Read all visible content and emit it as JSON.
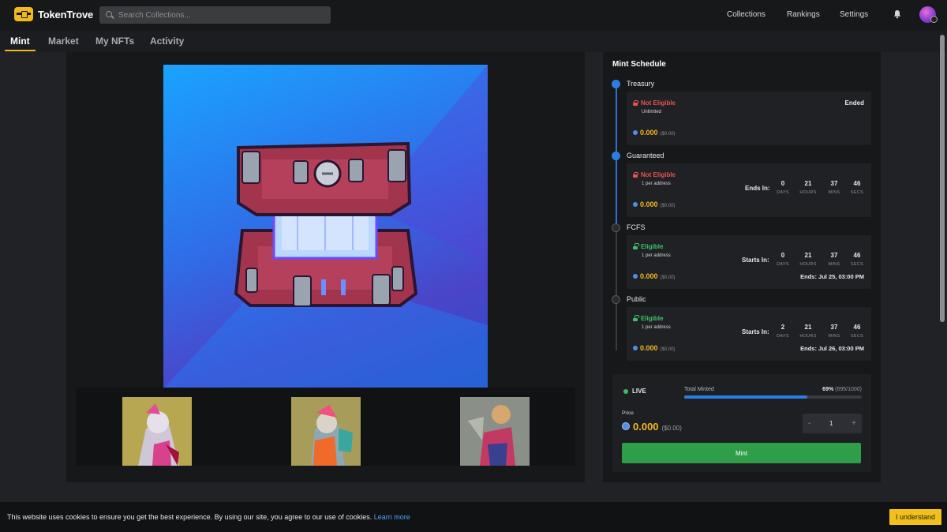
{
  "app": {
    "brand": "TokenTrove"
  },
  "search": {
    "placeholder": "Search Collections..."
  },
  "topnav": {
    "collections": "Collections",
    "rankings": "Rankings",
    "settings": "Settings"
  },
  "tabs": [
    {
      "label": "Mint",
      "active": true
    },
    {
      "label": "Market",
      "active": false
    },
    {
      "label": "My NFTs",
      "active": false
    },
    {
      "label": "Activity",
      "active": false
    }
  ],
  "schedule": {
    "title": "Mint Schedule",
    "phases": [
      {
        "name": "Treasury",
        "eligibility": "Not Eligible",
        "limit": "Unlimited",
        "status": "Ended",
        "price": "0.000",
        "price_usd": "($0.00)"
      },
      {
        "name": "Guaranteed",
        "eligibility": "Not Eligible",
        "limit": "1 per address",
        "countdown_label": "Ends In:",
        "countdown": [
          "0",
          "21",
          "37",
          "46"
        ],
        "price": "0.000",
        "price_usd": "($0.00)"
      },
      {
        "name": "FCFS",
        "eligibility": "Eligible",
        "limit": "1 per address",
        "countdown_label": "Starts In:",
        "countdown": [
          "0",
          "21",
          "37",
          "46"
        ],
        "price": "0.000",
        "price_usd": "($0.00)",
        "ends": "Ends: Jul 25, 03:00 PM"
      },
      {
        "name": "Public",
        "eligibility": "Eligible",
        "limit": "1 per address",
        "countdown_label": "Starts In:",
        "countdown": [
          "2",
          "21",
          "37",
          "46"
        ],
        "price": "0.000",
        "price_usd": "($0.00)",
        "ends": "Ends: Jul 26, 03:00 PM"
      }
    ],
    "units": [
      "DAYS",
      "HOURS",
      "MINS",
      "SECS"
    ]
  },
  "mint": {
    "status": "LIVE",
    "total_minted_label": "Total Minted",
    "percent": "69%",
    "count": "(695/1000)",
    "progress": 0.695,
    "price_label": "Price",
    "price": "0.000",
    "price_usd": "($0.00)",
    "quantity": "1",
    "minus": "-",
    "plus": "+",
    "button": "Mint"
  },
  "cookie": {
    "text": "This website uses cookies to ensure you get the best experience. By using our site, you agree to our use of cookies.",
    "link": "Learn more",
    "accept": "I understand"
  },
  "colors": {
    "accent": "#f2b91c",
    "live": "#3cc067",
    "danger": "#e55353",
    "progress": "#2a7de1",
    "mint_button": "#2f9e48"
  }
}
